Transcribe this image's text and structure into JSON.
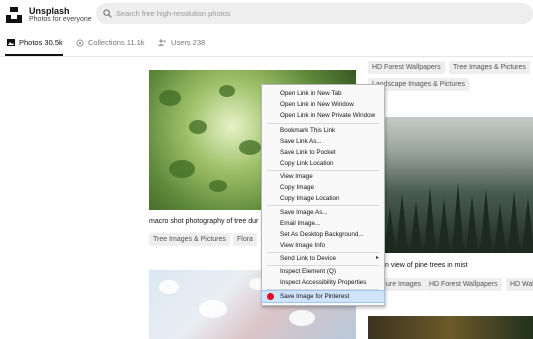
{
  "header": {
    "brand": "Unsplash",
    "tagline": "Photos for everyone",
    "search_placeholder": "Search free high-resolution photos"
  },
  "tabs": [
    {
      "label": "Photos 30.5k",
      "active": true
    },
    {
      "label": "Collections 11.1k",
      "active": false
    },
    {
      "label": "Users 238",
      "active": false
    }
  ],
  "left_column": {
    "caption": "macro shot photography of tree dur",
    "tags": [
      "Tree Images & Pictures",
      "Flora"
    ]
  },
  "right_column": {
    "tags_top": [
      "HD Forest Wallpapers",
      "Tree Images & Pictures",
      "Landscape Images & Pictures"
    ],
    "caption": "n view of pine trees in mist",
    "tags_bottom": [
      "ure Images",
      "HD Forest Wallpapers",
      "HD Wal"
    ]
  },
  "context_menu": {
    "items": [
      {
        "label": "Open Link in New Tab"
      },
      {
        "label": "Open Link in New Window"
      },
      {
        "label": "Open Link in New Private Window"
      },
      {
        "label": "Bookmark This Link"
      },
      {
        "label": "Save Link As..."
      },
      {
        "label": "Save Link to Pocket"
      },
      {
        "label": "Copy Link Location"
      },
      {
        "label": "View Image"
      },
      {
        "label": "Copy Image"
      },
      {
        "label": "Copy Image Location"
      },
      {
        "label": "Save Image As..."
      },
      {
        "label": "Email Image..."
      },
      {
        "label": "Set As Desktop Background..."
      },
      {
        "label": "View Image Info"
      },
      {
        "label": "Send Link to Device"
      },
      {
        "label": "Inspect Element (Q)"
      },
      {
        "label": "Inspect Accessibility Properties"
      },
      {
        "label": "Save Image for Pinterest",
        "highlighted": true
      }
    ]
  },
  "colors": {
    "pinterest": "#e60023",
    "highlight": "#cfe3fb"
  }
}
